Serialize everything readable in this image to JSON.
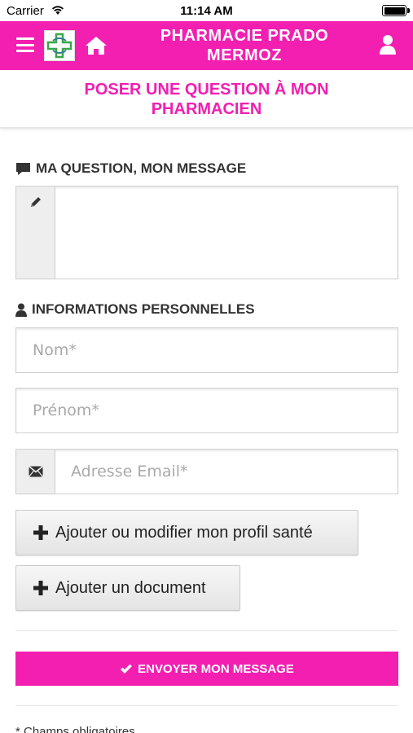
{
  "status_bar": {
    "carrier": "Carrier",
    "time": "11:14 AM"
  },
  "header": {
    "title": "PHARMACIE PRADO MERMOZ",
    "icons": [
      "menu-icon",
      "pharmacy-logo-icon",
      "home-icon",
      "user-icon"
    ]
  },
  "page": {
    "title": "POSER UNE QUESTION À MON PHARMACIEN"
  },
  "message_section": {
    "label": "MA QUESTION, MON MESSAGE",
    "icon": "comment-icon",
    "textarea_value": "",
    "addon_icon": "pencil-icon"
  },
  "personal_section": {
    "label": "INFORMATIONS PERSONNELLES",
    "icon": "user-icon",
    "fields": {
      "nom_placeholder": "Nom*",
      "prenom_placeholder": "Prénom*",
      "email_placeholder": "Adresse Email*"
    }
  },
  "buttons": {
    "profile_label": "Ajouter ou modifier mon profil santé",
    "document_label": "Ajouter un document",
    "send_label": "ENVOYER MON MESSAGE"
  },
  "footer": {
    "required_note": "* Champs obligatoires"
  },
  "colors": {
    "brand": "#f21fb1",
    "addon_bg": "#eeeeee",
    "border": "#cfcfcf"
  }
}
